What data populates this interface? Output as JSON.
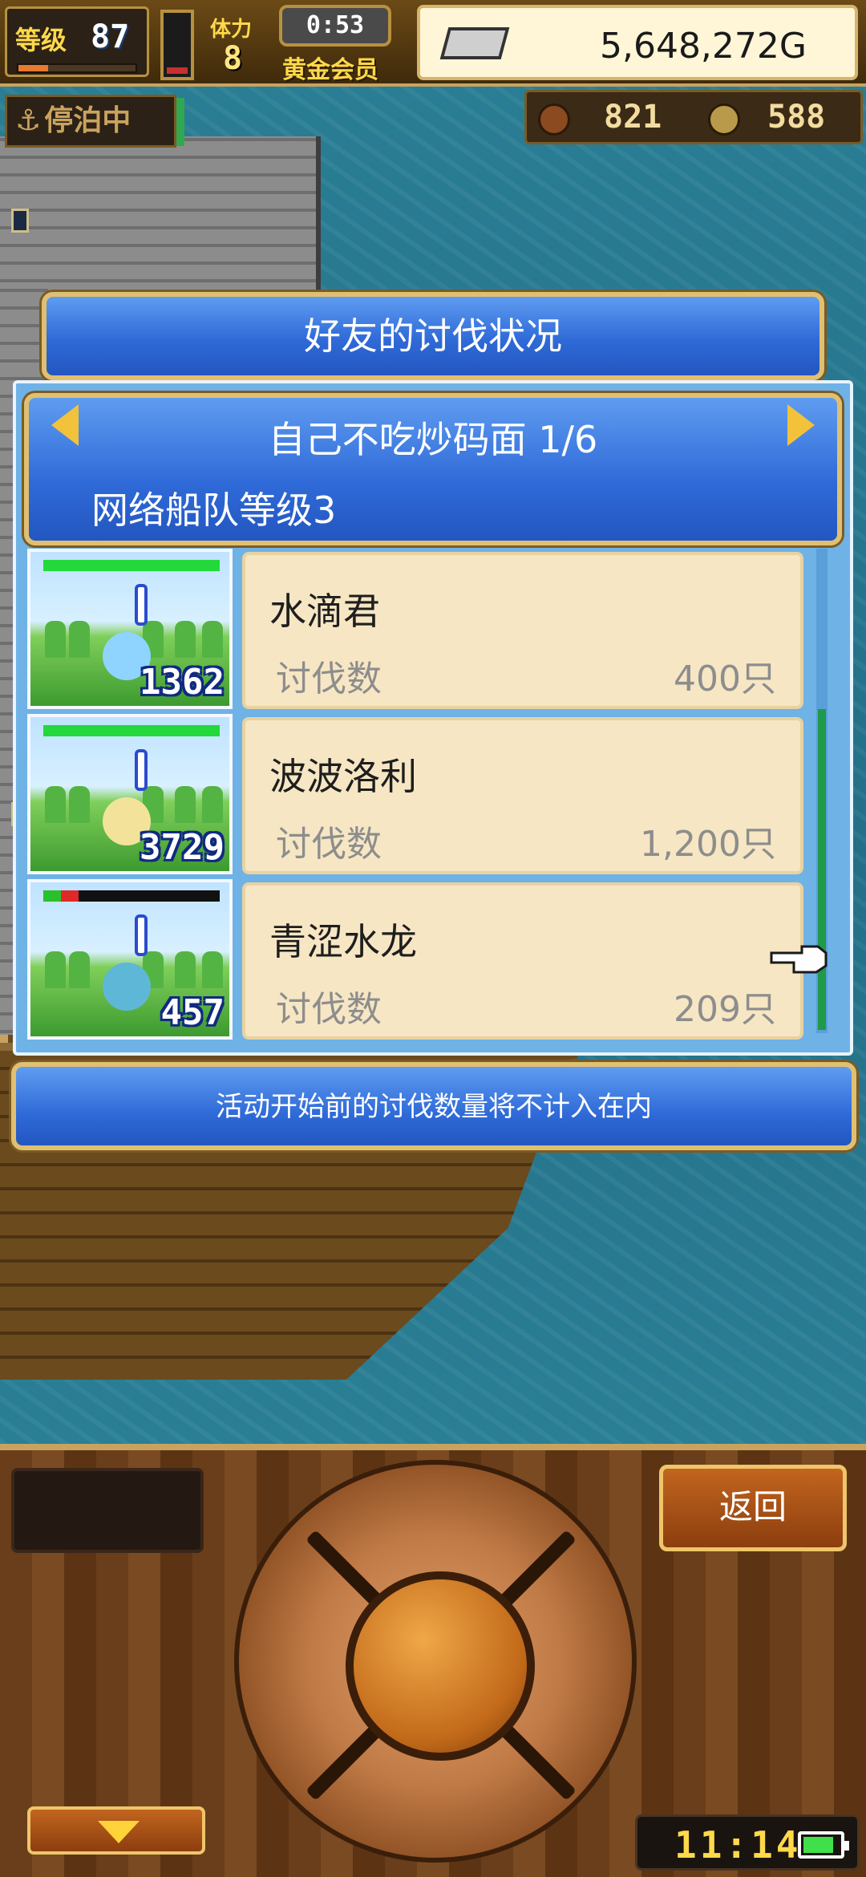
{
  "hud": {
    "level_label": "等级",
    "level_value": "87",
    "level_progress": 0.25,
    "stamina_fill": 0.1,
    "tili_label": "体力",
    "tili_value": "8",
    "timer": "0:53",
    "membership": "黄金会员",
    "gold": "5,648,272G",
    "status": "停泊中",
    "resource_1": "821",
    "resource_2": "588"
  },
  "dialog": {
    "title": "好友的讨伐状况",
    "friend_name": "自己不吃炒码面 1/6",
    "fleet_level": "网络船队等级3",
    "kill_label": "讨伐数",
    "entries": [
      {
        "name": "水滴君",
        "count": "400只",
        "thumb_number": "1362",
        "hp": 1.0,
        "hp_red": 0.0,
        "monster_color": "#8fd3ff"
      },
      {
        "name": "波波洛利",
        "count": "1,200只",
        "thumb_number": "3729",
        "hp": 1.0,
        "hp_red": 0.0,
        "monster_color": "#f3e39a"
      },
      {
        "name": "青涩水龙",
        "count": "209只",
        "thumb_number": "457",
        "hp": 0.1,
        "hp_red": 0.1,
        "monster_color": "#5fb7d8"
      }
    ],
    "footer_note": "活动开始前的讨伐数量将不计入在内"
  },
  "controls": {
    "back_label": "返回",
    "clock": "11:14",
    "battery_level": 0.85
  },
  "colors": {
    "dialog_blue": "#2f6ad8",
    "card_bg": "#f6e6c3",
    "gold_accent": "#f2c23a"
  }
}
